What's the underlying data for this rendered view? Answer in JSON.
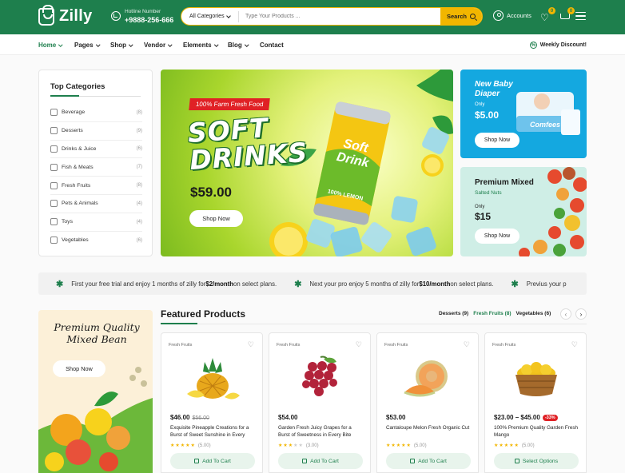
{
  "header": {
    "logo_text": "Zilly",
    "hotline_label": "Hotline Number",
    "hotline_number": "+9888-256-666",
    "search": {
      "category": "All Categories",
      "placeholder": "Type Your Products ...",
      "button": "Search"
    },
    "accounts_label": "Accounts",
    "wishlist_count": "0",
    "cart_count": "0"
  },
  "nav": {
    "items": [
      {
        "label": "Home",
        "active": true
      },
      {
        "label": "Pages"
      },
      {
        "label": "Shop"
      },
      {
        "label": "Vendor"
      },
      {
        "label": "Elements"
      },
      {
        "label": "Blog"
      },
      {
        "label": "Contact"
      }
    ],
    "weekly": "Weekly Discount!"
  },
  "categories": {
    "title": "Top Categories",
    "items": [
      {
        "name": "Beverage",
        "count": "(8)"
      },
      {
        "name": "Desserts",
        "count": "(9)"
      },
      {
        "name": "Drinks & Juice",
        "count": "(6)"
      },
      {
        "name": "Fish & Meats",
        "count": "(7)"
      },
      {
        "name": "Fresh Fruits",
        "count": "(8)"
      },
      {
        "name": "Pets & Animals",
        "count": "(4)"
      },
      {
        "name": "Toys",
        "count": "(4)"
      },
      {
        "name": "Vegetables",
        "count": "(6)"
      }
    ]
  },
  "hero": {
    "tag": "100% Farm Fresh Food",
    "title_line1": "SOFT",
    "title_line2": "DRINKS",
    "price": "$59.00",
    "button": "Shop Now",
    "can_text1": "Soft",
    "can_text2": "Drink",
    "can_text3": "100% LEMON"
  },
  "promo1": {
    "title_line1": "New Baby",
    "title_line2": "Diaper",
    "only": "Only",
    "price": "$5.00",
    "button": "Shop Now",
    "pack_text": "Comfees"
  },
  "promo2": {
    "title": "Premium Mixed",
    "subtitle": "Salted Nuts",
    "only": "Only",
    "price": "$15",
    "button": "Shop Now"
  },
  "ticker": {
    "items": [
      {
        "pre": "First your free trial and enjoy 1 months of zilly for ",
        "bold": "$2/month",
        "post": " on select plans."
      },
      {
        "pre": "Next your pro enjoy 5 months of zilly for",
        "bold": "$10/month",
        "post": "on select plans."
      },
      {
        "pre": "Previus your p",
        "bold": "",
        "post": ""
      }
    ]
  },
  "side_banner": {
    "title_line1": "Premium Quality",
    "title_line2": "Mixed Bean",
    "button": "Shop Now"
  },
  "featured": {
    "title": "Featured Products",
    "tabs": [
      {
        "label": "Desserts (9)",
        "active": false
      },
      {
        "label": "Fresh Fruits (8)",
        "active": true
      },
      {
        "label": "Vegetables (6)",
        "active": false
      }
    ],
    "products": [
      {
        "category": "Fresh Fruits",
        "price": "$46.00",
        "old_price": "$56.00",
        "sale": "",
        "name": "Exquisite Pineapple Creations for a Burst of Sweet Sunshine in Every",
        "rating": 5,
        "rating_text": "(5.00)",
        "button": "Add To Cart",
        "image": "pineapple-image"
      },
      {
        "category": "Fresh Fruits",
        "price": "$54.00",
        "old_price": "",
        "sale": "",
        "name": "Garden Fresh Juicy Grapes for a Burst of Sweetness in Every Bite",
        "rating": 3,
        "rating_text": "(3.00)",
        "button": "Add To Cart",
        "image": "grapes-image"
      },
      {
        "category": "Fresh Fruits",
        "price": "$53.00",
        "old_price": "",
        "sale": "",
        "name": "Cantaloupe Melon Fresh Organic Cut",
        "rating": 5,
        "rating_text": "(5.00)",
        "button": "Add To Cart",
        "image": "melon-image"
      },
      {
        "category": "Fresh Fruits",
        "price": "$23.00 – $45.00",
        "old_price": "",
        "sale": "-33%",
        "name": "100% Premium Quality Garden Fresh Mango",
        "rating": 5,
        "rating_text": "(5.00)",
        "button": "Select Options",
        "image": "mango-basket-image"
      }
    ]
  },
  "colors": {
    "primary": "#1e7f4d",
    "accent": "#f2b600",
    "sale": "#e02125"
  }
}
